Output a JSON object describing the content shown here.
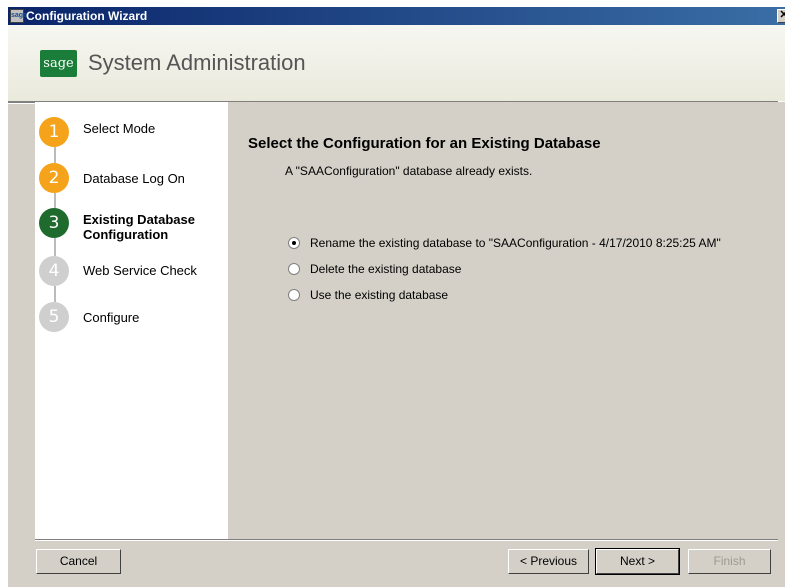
{
  "window": {
    "title": "Configuration Wizard",
    "icon_label": "sage",
    "close_glyph": "✕"
  },
  "header": {
    "logo_text": "sage",
    "app_title": "System Administration"
  },
  "steps": [
    {
      "number": "1",
      "label": "Select Mode",
      "state": "done",
      "color": "#f5a31a"
    },
    {
      "number": "2",
      "label": "Database Log On",
      "state": "done",
      "color": "#f5a31a"
    },
    {
      "number": "3",
      "label": "Existing Database Configuration",
      "state": "current",
      "color": "#1f6b2e"
    },
    {
      "number": "4",
      "label": "Web Service Check",
      "state": "pending",
      "color": "#cfcfcf"
    },
    {
      "number": "5",
      "label": "Configure",
      "state": "pending",
      "color": "#cfcfcf"
    }
  ],
  "content": {
    "heading": "Select the Configuration for an Existing Database",
    "description": "A \"SAAConfiguration\" database already exists.",
    "options": [
      {
        "label": "Rename the existing database to \"SAAConfiguration - 4/17/2010 8:25:25 AM\"",
        "checked": true
      },
      {
        "label": "Delete the existing database",
        "checked": false
      },
      {
        "label": "Use the existing database",
        "checked": false
      }
    ]
  },
  "buttons": {
    "cancel": "Cancel",
    "previous": "< Previous",
    "next": "Next >",
    "finish": "Finish"
  }
}
